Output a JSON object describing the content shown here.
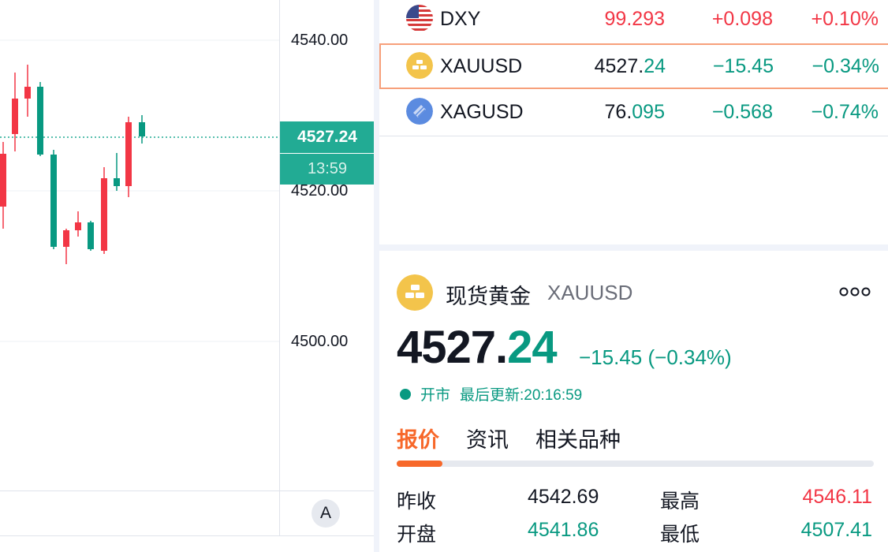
{
  "chart": {
    "axis_labels": [
      "4540.00",
      "4520.00",
      "4500.00"
    ],
    "last_price": "4527.24",
    "countdown": "13:59",
    "auto_scale": "A",
    "colors": {
      "up": "#f23645",
      "down": "#089981",
      "tag": "#22ab94"
    }
  },
  "watchlist": {
    "rows": [
      {
        "symbol": "DXY",
        "last": "99.293",
        "last_int": "",
        "last_dec": "",
        "change": "+0.098",
        "change_pct": "+0.10%",
        "icon": "us-flag-icon",
        "trend": "up"
      },
      {
        "symbol": "XAUUSD",
        "last": "4527.24",
        "last_int": "4527.",
        "last_dec": "24",
        "change": "−15.45",
        "change_pct": "−0.34%",
        "icon": "gold-bars-icon",
        "trend": "down"
      },
      {
        "symbol": "XAGUSD",
        "last": "76.095",
        "last_int": "76.",
        "last_dec": "095",
        "change": "−0.568",
        "change_pct": "−0.74%",
        "icon": "silver-bars-icon",
        "trend": "down"
      }
    ]
  },
  "detail": {
    "name": "现货黄金",
    "symbol": "XAUUSD",
    "price_int": "4527.",
    "price_dec": "24",
    "change": "−15.45 (−0.34%)",
    "status": "开市",
    "updated": "最后更新:20:16:59",
    "tabs": [
      "报价",
      "资讯",
      "相关品种"
    ],
    "active_tab": "报价",
    "stats": [
      {
        "label": "昨收",
        "value": "4542.69",
        "color": "#131722"
      },
      {
        "label": "最高",
        "value": "4546.11",
        "color": "#f23645"
      },
      {
        "label": "开盘",
        "value": "4541.86",
        "color": "#089981"
      },
      {
        "label": "最低",
        "value": "4507.41",
        "color": "#089981"
      }
    ]
  }
}
